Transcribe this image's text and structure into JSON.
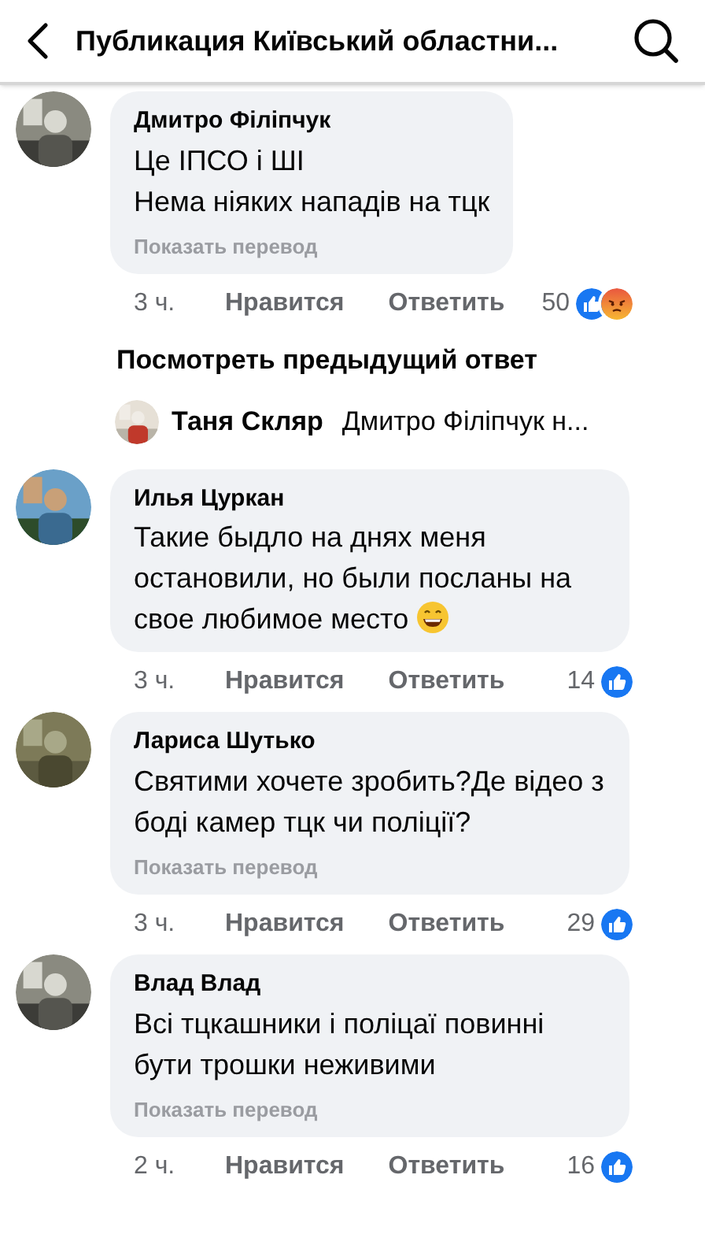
{
  "header": {
    "title": "Публикация Київський областни..."
  },
  "items": [
    {
      "kind": "comment",
      "author": "Дмитро Філіпчук",
      "paragraphs": [
        "Це ІПСО і ШІ",
        "Нема ніяких нападів на тцк"
      ],
      "translate": "Показать перевод",
      "time": "3 ч.",
      "like": "Нравится",
      "reply": "Ответить",
      "count": "50",
      "reactions": [
        {
          "kind": "like"
        },
        {
          "kind": "angry"
        }
      ]
    },
    {
      "kind": "view_previous",
      "text": "Посмотреть предыдущий ответ"
    },
    {
      "kind": "collapsed_reply",
      "author": "Таня Скляр",
      "text": "Дмитро Філіпчук н..."
    },
    {
      "kind": "comment",
      "author": "Илья Цуркан",
      "paragraphs": [
        "Такие быдло на днях меня остановили, но были посланы на свое любимое место"
      ],
      "emoji": {
        "kind": "grin"
      },
      "time": "3 ч.",
      "like": "Нравится",
      "reply": "Ответить",
      "count": "14",
      "reactions": [
        {
          "kind": "like"
        }
      ]
    },
    {
      "kind": "comment",
      "author": "Лариса Шутько",
      "paragraphs": [
        "Святими хочете зробить?Де відео з боді камер тцк чи поліції?"
      ],
      "translate": "Показать перевод",
      "time": "3 ч.",
      "like": "Нравится",
      "reply": "Ответить",
      "count": "29",
      "reactions": [
        {
          "kind": "like"
        }
      ]
    },
    {
      "kind": "comment",
      "author": "Влад Влад",
      "paragraphs": [
        "Всі тцкашники і поліцаї повинні бути трошки неживими"
      ],
      "translate": "Показать перевод",
      "time": "2 ч.",
      "like": "Нравится",
      "reply": "Ответить",
      "count": "16",
      "reactions": [
        {
          "kind": "like"
        }
      ]
    }
  ]
}
